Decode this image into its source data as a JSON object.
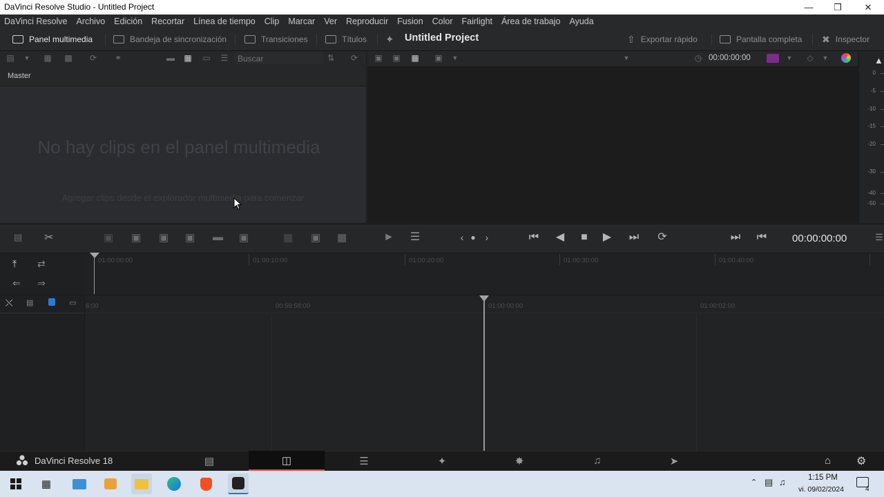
{
  "window": {
    "title": "DaVinci Resolve Studio - Untitled Project"
  },
  "menu": {
    "items": [
      "DaVinci Resolve",
      "Archivo",
      "Edición",
      "Recortar",
      "Línea de tiempo",
      "Clip",
      "Marcar",
      "Ver",
      "Reproducir",
      "Fusion",
      "Color",
      "Fairlight",
      "Área de trabajo",
      "Ayuda"
    ]
  },
  "toolbar": {
    "media_pool": "Panel multimedia",
    "sync_bin": "Bandeja de sincronización",
    "transitions": "Transiciones",
    "titles": "Títulos",
    "project_title": "Untitled Project",
    "quick_export": "Exportar rápido",
    "full_screen": "Pantalla completa",
    "inspector": "Inspector"
  },
  "media_pool": {
    "search_placeholder": "Buscar",
    "bin": "Master",
    "empty_title": "No hay clips en el panel multimedia",
    "empty_subtitle": "Agregar clips desde el explorador multimedia para comenzar"
  },
  "viewer": {
    "timecode": "00:00:00:00"
  },
  "meters": {
    "labels": [
      "0",
      "-5",
      "-10",
      "-15",
      "-20",
      "-30",
      "-40",
      "-50"
    ]
  },
  "transport": {
    "timecode": "00:00:00:00"
  },
  "timeline": {
    "upper_ruler": [
      "01:00:00:00",
      "01:00:10:00",
      "01:00:20:00",
      "01:00:30:00",
      "01:00:40:00"
    ],
    "lower_ruler": [
      "6:00",
      "00:59:58:00",
      "01:00:00:00",
      "01:00:02:00"
    ]
  },
  "pagebar": {
    "app_name": "DaVinci Resolve 18"
  },
  "taskbar": {
    "time": "1:15 PM",
    "date": "vi. 09/02/2024",
    "notification_count": "4"
  },
  "colors": {
    "accent": "#e0484f",
    "panel": "#262729",
    "background": "#1f2022"
  }
}
